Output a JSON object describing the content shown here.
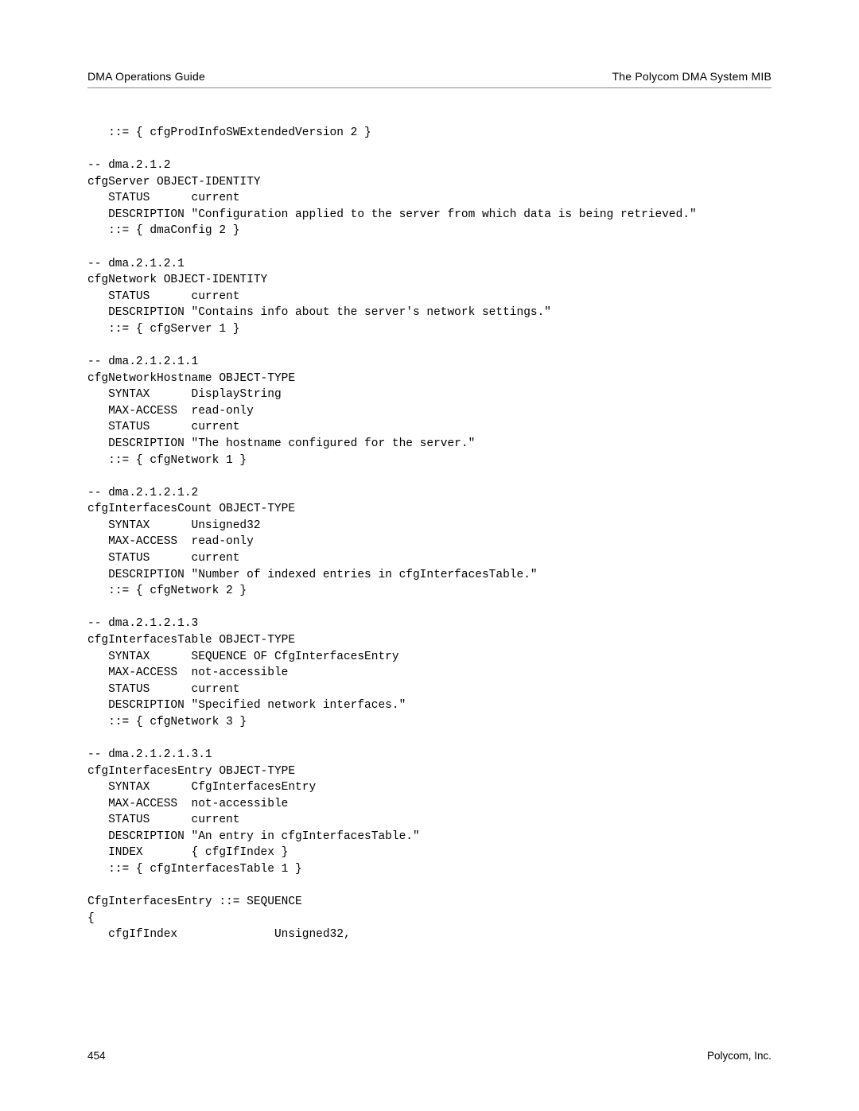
{
  "header": {
    "left": "DMA Operations Guide",
    "right": "The Polycom DMA System MIB"
  },
  "code": "   ::= { cfgProdInfoSWExtendedVersion 2 }\n\n-- dma.2.1.2\ncfgServer OBJECT-IDENTITY\n   STATUS      current\n   DESCRIPTION \"Configuration applied to the server from which data is being retrieved.\"\n   ::= { dmaConfig 2 }\n\n-- dma.2.1.2.1\ncfgNetwork OBJECT-IDENTITY\n   STATUS      current\n   DESCRIPTION \"Contains info about the server's network settings.\"\n   ::= { cfgServer 1 }\n\n-- dma.2.1.2.1.1\ncfgNetworkHostname OBJECT-TYPE\n   SYNTAX      DisplayString\n   MAX-ACCESS  read-only\n   STATUS      current\n   DESCRIPTION \"The hostname configured for the server.\"\n   ::= { cfgNetwork 1 }\n\n-- dma.2.1.2.1.2\ncfgInterfacesCount OBJECT-TYPE\n   SYNTAX      Unsigned32\n   MAX-ACCESS  read-only\n   STATUS      current\n   DESCRIPTION \"Number of indexed entries in cfgInterfacesTable.\"\n   ::= { cfgNetwork 2 }\n\n-- dma.2.1.2.1.3\ncfgInterfacesTable OBJECT-TYPE\n   SYNTAX      SEQUENCE OF CfgInterfacesEntry\n   MAX-ACCESS  not-accessible\n   STATUS      current\n   DESCRIPTION \"Specified network interfaces.\"\n   ::= { cfgNetwork 3 }\n\n-- dma.2.1.2.1.3.1\ncfgInterfacesEntry OBJECT-TYPE\n   SYNTAX      CfgInterfacesEntry\n   MAX-ACCESS  not-accessible\n   STATUS      current\n   DESCRIPTION \"An entry in cfgInterfacesTable.\"\n   INDEX       { cfgIfIndex }\n   ::= { cfgInterfacesTable 1 }\n\nCfgInterfacesEntry ::= SEQUENCE\n{\n   cfgIfIndex              Unsigned32,",
  "footer": {
    "page_number": "454",
    "company": "Polycom, Inc."
  }
}
